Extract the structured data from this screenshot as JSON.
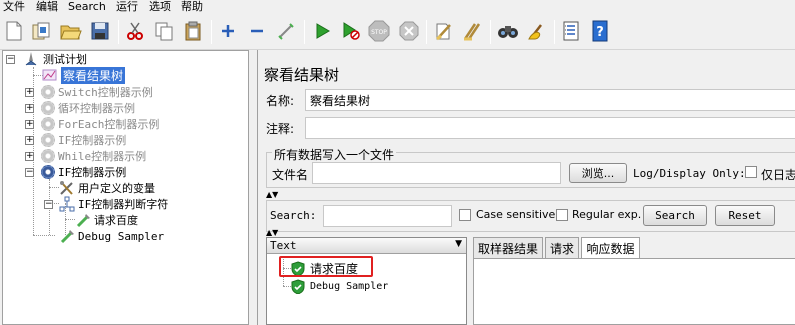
{
  "menu": [
    "文件",
    "编辑",
    "Search",
    "运行",
    "选项",
    "帮助"
  ],
  "toolbar": [
    {
      "name": "new-icon"
    },
    {
      "name": "templates-icon"
    },
    {
      "name": "open-icon"
    },
    {
      "name": "save-icon"
    },
    {
      "name": "cut-icon"
    },
    {
      "name": "copy-icon"
    },
    {
      "name": "paste-icon"
    },
    {
      "name": "expand-icon"
    },
    {
      "name": "collapse-icon"
    },
    {
      "name": "toggle-icon"
    },
    {
      "name": "start-icon"
    },
    {
      "name": "start-no-timers-icon"
    },
    {
      "name": "stop-icon"
    },
    {
      "name": "shutdown-icon"
    },
    {
      "name": "clear-icon"
    },
    {
      "name": "clear-all-icon"
    },
    {
      "name": "search-icon"
    },
    {
      "name": "reset-search-icon"
    },
    {
      "name": "function-helper-icon"
    },
    {
      "name": "help-icon"
    }
  ],
  "tree": {
    "root": "测试计划",
    "items": [
      "察看结果树",
      "Switch控制器示例",
      "循环控制器示例",
      "ForEach控制器示例",
      "IF控制器示例",
      "While控制器示例",
      "IF控制器示例"
    ],
    "children": [
      "用户定义的变量",
      "IF控制器判断字符",
      "请求百度",
      "Debug Sampler"
    ]
  },
  "panel": {
    "title": "察看结果树",
    "name_label": "名称:",
    "name_value": "察看结果树",
    "comment_label": "注释:",
    "group_title": "所有数据写入一个文件",
    "filename_label": "文件名",
    "filename_value": "",
    "browse_button": "浏览...",
    "log_display": "Log/Display Only:",
    "errors_only": "仅日志",
    "search_label": "Search:",
    "search_value": "",
    "case_sensitive": "Case sensitive",
    "regular_exp": "Regular exp.",
    "search_button": "Search",
    "reset_button": "Reset",
    "renderer": "Text",
    "results": [
      "请求百度",
      "Debug Sampler"
    ],
    "tabs": [
      "取样器结果",
      "请求",
      "响应数据"
    ],
    "active_tab": 2,
    "highlight_color": "#e02020"
  }
}
